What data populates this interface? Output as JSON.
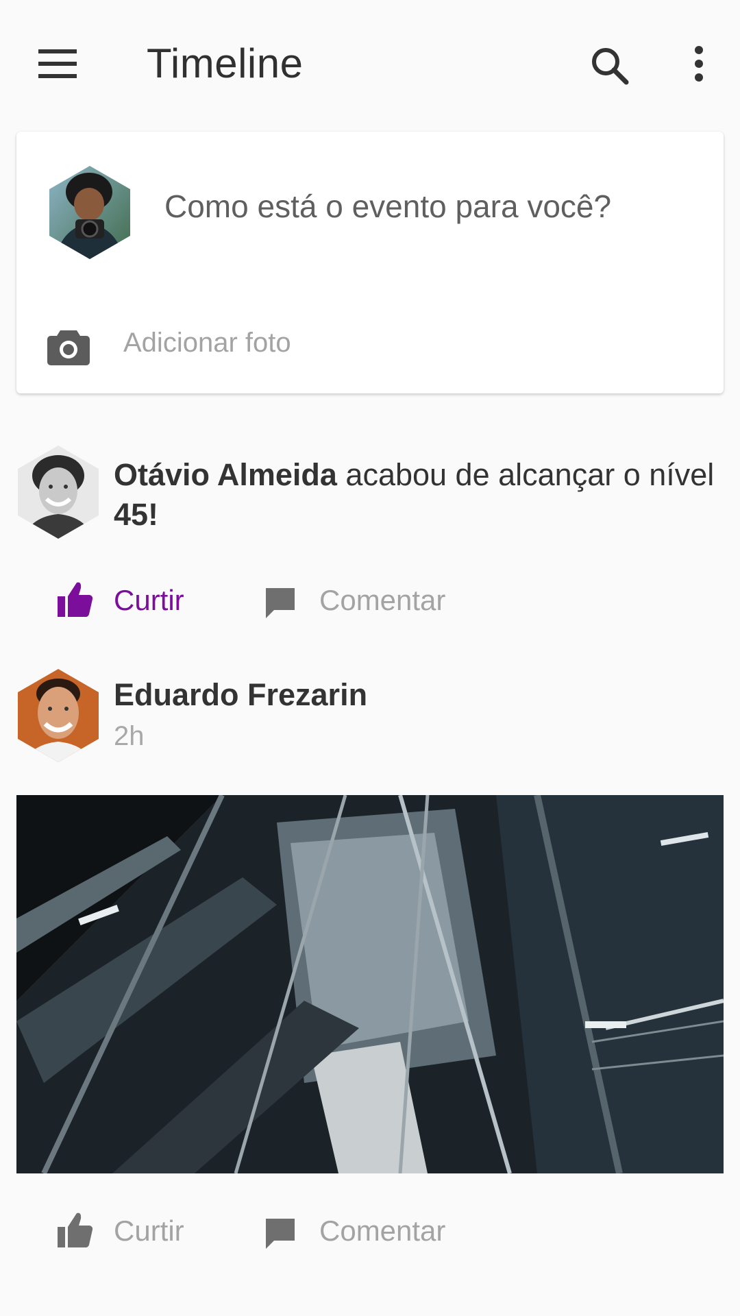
{
  "appbar": {
    "title": "Timeline",
    "icons": [
      "menu-icon",
      "search-icon",
      "more-vert-icon"
    ]
  },
  "composer": {
    "prompt": "Como está o evento para você?",
    "add_photo_label": "Adicionar foto",
    "icons": [
      "camera-icon"
    ]
  },
  "posts": [
    {
      "author": "Otávio Almeida",
      "text_middle": " acabou de alcançar o nível ",
      "level": "45!",
      "like_label": "Curtir",
      "like_active": true,
      "comment_label": "Comentar"
    },
    {
      "author": "Eduardo Frezarin",
      "time": "2h",
      "like_label": "Curtir",
      "like_active": false,
      "comment_label": "Comentar"
    }
  ],
  "colors": {
    "accent": "#7b0f9b",
    "icon_gray": "#6f6f6f",
    "text_dark": "#303030",
    "text_muted": "#a3a3a3",
    "background": "#fafafa"
  }
}
